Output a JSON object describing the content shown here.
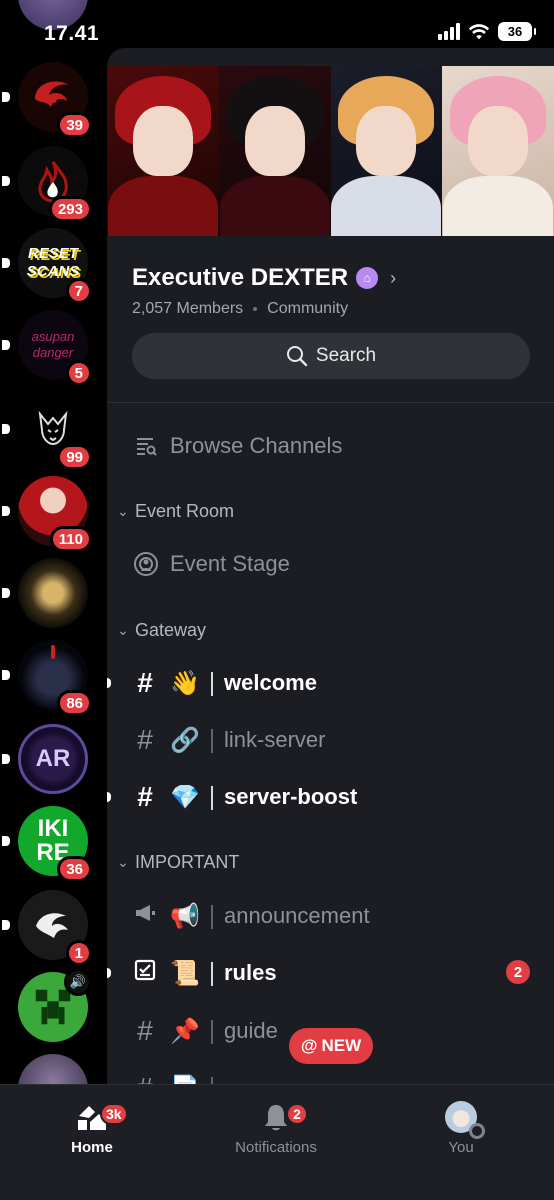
{
  "status_bar": {
    "time": "17.41",
    "battery": "36"
  },
  "servers": [
    {
      "name": "server-top-partial",
      "badge": "",
      "unread": true,
      "colors": [
        "#3b2e5a",
        "#7a6aa0"
      ]
    },
    {
      "name": "server-dragon",
      "badge": "39",
      "unread": true,
      "colors": [
        "#1a0505",
        "#c41e1e"
      ]
    },
    {
      "name": "server-flame",
      "badge": "293",
      "unread": true,
      "colors": [
        "#0b0b0b",
        "#b01212"
      ]
    },
    {
      "name": "server-reset-scans",
      "badge": "7",
      "unread": true,
      "colors": [
        "#111111",
        "#f4d000"
      ],
      "logo_text": "RESET SCANS"
    },
    {
      "name": "server-asupan",
      "badge": "5",
      "unread": true,
      "colors": [
        "#0c0610",
        "#6a1f4a"
      ],
      "logo_text": "asupan danger"
    },
    {
      "name": "server-wolf-logo",
      "badge": "99",
      "unread": true,
      "colors": [
        "#000000",
        "#dddddd"
      ]
    },
    {
      "name": "server-redhair",
      "badge": "110",
      "unread": true,
      "colors": [
        "#2a0a0a",
        "#b5161b"
      ]
    },
    {
      "name": "server-gold",
      "badge": "",
      "unread": true,
      "colors": [
        "#0f0d08",
        "#d8b46a"
      ]
    },
    {
      "name": "server-dark-figure",
      "badge": "86",
      "unread": true,
      "colors": [
        "#05060c",
        "#2a2f4a"
      ]
    },
    {
      "name": "server-ak",
      "badge": "",
      "unread": true,
      "colors": [
        "#150c2a",
        "#a58cf0"
      ],
      "logo_text": "AR"
    },
    {
      "name": "server-green-ki",
      "badge": "36",
      "unread": true,
      "colors": [
        "#12a82b",
        "#ffffff"
      ],
      "logo_text": "IKI RE"
    },
    {
      "name": "server-white-swirl",
      "badge": "1",
      "unread": true,
      "colors": [
        "#1a1a1a",
        "#eeeeee"
      ]
    },
    {
      "name": "server-creeper",
      "badge": "",
      "unread": false,
      "colors": [
        "#3aa83a",
        "#0d3a0d"
      ],
      "voice": true
    },
    {
      "name": "server-bottom-partial",
      "badge": "",
      "unread": false,
      "colors": [
        "#2c2434",
        "#8a7aa0"
      ]
    }
  ],
  "header": {
    "server_name": "Executive DEXTER",
    "members": "2,057 Members",
    "type": "Community",
    "search_label": "Search"
  },
  "browse_channels": "Browse Channels",
  "categories": {
    "event_room": "Event Room",
    "gateway": "Gateway",
    "important": "IMPORTANT"
  },
  "event_stage": "Event Stage",
  "channels": {
    "welcome": {
      "emoji": "👋",
      "name": "welcome"
    },
    "link_server": {
      "emoji": "🔗",
      "name": "link-server"
    },
    "server_boost": {
      "emoji": "💎",
      "name": "server-boost"
    },
    "announcement": {
      "emoji": "📢",
      "name": "announcement"
    },
    "rules": {
      "emoji": "📜",
      "name": "rules",
      "count": "2"
    },
    "guide": {
      "emoji": "📌",
      "name": "guide"
    },
    "partial": {
      "emoji": "📄",
      "name": ""
    }
  },
  "new_pill": {
    "at": "@",
    "label": "NEW"
  },
  "tabs": {
    "home": {
      "label": "Home",
      "badge": "3k"
    },
    "notifications": {
      "label": "Notifications",
      "badge": "2"
    },
    "you": {
      "label": "You"
    }
  },
  "accent_colors": {
    "badge_red": "#e23d43",
    "panel_bg": "#1c1d22",
    "rail_bg": "#000000"
  }
}
